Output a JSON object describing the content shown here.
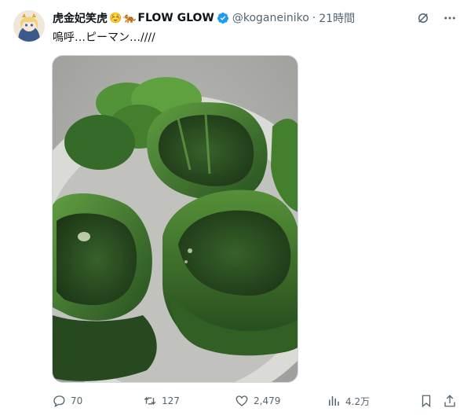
{
  "tweet": {
    "display_name": "虎金妃笑虎",
    "emoji_1": "☺️",
    "emoji_2": "🐅",
    "brand": "FLOW GLOW",
    "handle": "@koganeiniko",
    "separator": "·",
    "time": "21時間",
    "text": "嗚呼…ピーマン…////"
  },
  "actions": {
    "replies": "70",
    "reposts": "127",
    "likes": "2,479",
    "views": "4.2万"
  },
  "colors": {
    "verified": "#1d9bf0",
    "muted": "#536471",
    "text": "#0f1419"
  }
}
